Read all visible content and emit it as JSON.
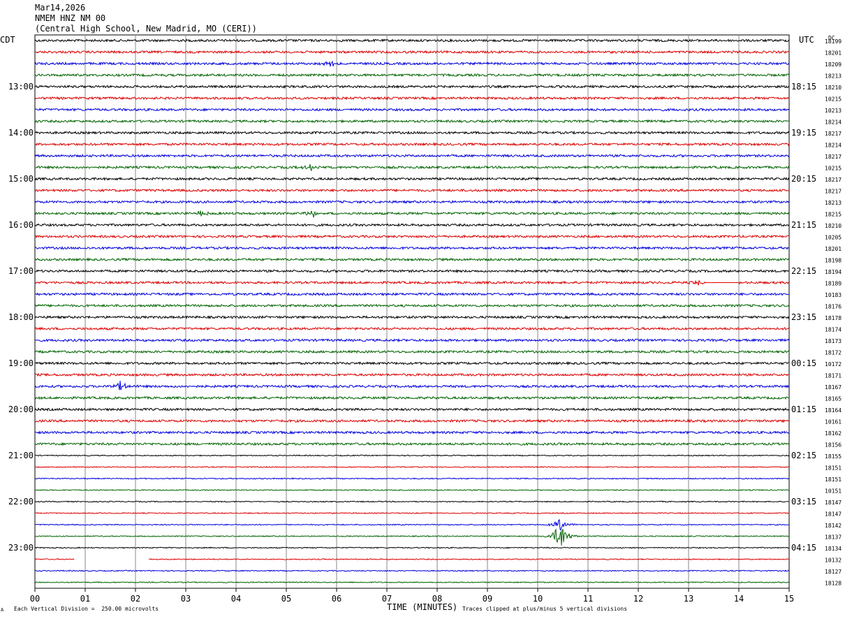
{
  "header": {
    "date": "Mar14,2026",
    "station": "NMEM HNZ NM 00",
    "location": "(Central High School, New Madrid, MO (CERI))"
  },
  "left_zone_label": "CDT",
  "right_zone_label": "UTC",
  "dc_label": "DC",
  "footer": {
    "scale_note": "Each Vertical Division =  250.00 microvolts",
    "clip_note": "Traces clipped at plus/minus 5 vertical divisions",
    "corner_mark": "A"
  },
  "colors": {
    "cycle": [
      "#000000",
      "#dd0000",
      "#0000dd",
      "#006400"
    ],
    "grid": "#888888"
  },
  "chart_data": {
    "type": "line",
    "title": "NMEM HNZ NM 00",
    "xlabel": "TIME (MINUTES)",
    "xlim": [
      0,
      15
    ],
    "x_ticks": [
      "00",
      "01",
      "02",
      "03",
      "04",
      "05",
      "06",
      "07",
      "08",
      "09",
      "10",
      "11",
      "12",
      "13",
      "14",
      "15"
    ],
    "left_hour_labels": [
      "13:00",
      "14:00",
      "15:00",
      "16:00",
      "17:00",
      "18:00",
      "19:00",
      "20:00",
      "21:00",
      "22:00",
      "23:00"
    ],
    "right_hour_labels": [
      "18:15",
      "19:15",
      "20:15",
      "21:15",
      "22:15",
      "23:15",
      "00:15",
      "01:15",
      "02:15",
      "03:15",
      "04:15"
    ],
    "first_hour_label_row": 4,
    "row_count": 48,
    "dc_offsets": [
      "18199",
      "18201",
      "18209",
      "18213",
      "18210",
      "10215",
      "10213",
      "18214",
      "18217",
      "18214",
      "18217",
      "10215",
      "18217",
      "18217",
      "18213",
      "18215",
      "18210",
      "10205",
      "18201",
      "18198",
      "18194",
      "18189",
      "10183",
      "18176",
      "18178",
      "18174",
      "18173",
      "18172",
      "10172",
      "18171",
      "18167",
      "18165",
      "18164",
      "10161",
      "18162",
      "18156",
      "18155",
      "18151",
      "18151",
      "10151",
      "18147",
      "18147",
      "18142",
      "18137",
      "18134",
      "10132",
      "18127",
      "18128"
    ],
    "events": [
      {
        "row": 2,
        "minute": 5.9,
        "amp": 4
      },
      {
        "row": 11,
        "minute": 5.5,
        "amp": 5
      },
      {
        "row": 15,
        "minute": 3.3,
        "amp": 4
      },
      {
        "row": 15,
        "minute": 5.5,
        "amp": 7
      },
      {
        "row": 21,
        "minute": 13.2,
        "amp": 3
      },
      {
        "row": 30,
        "minute": 1.7,
        "amp": 7
      },
      {
        "row": 42,
        "minute": 10.45,
        "amp": 9
      },
      {
        "row": 43,
        "minute": 10.45,
        "amp": 22
      }
    ],
    "gaps": [
      {
        "row": 21,
        "from_minute": 13.3,
        "to_minute": 14.0,
        "flat": true
      },
      {
        "row": 45,
        "from_minute": 0.78,
        "to_minute": 2.25
      }
    ]
  }
}
